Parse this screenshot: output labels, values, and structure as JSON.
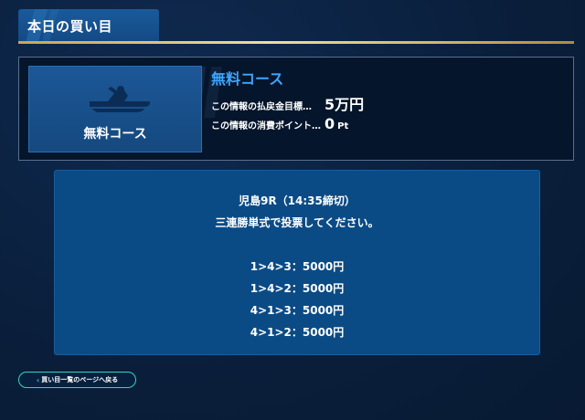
{
  "header": {
    "tab_title": "本日の買い目"
  },
  "course": {
    "thumbnail_label": "無料コース",
    "title": "無料コース",
    "rows": [
      {
        "label": "この情報の払戻金目標…",
        "value": "5万円",
        "unit": ""
      },
      {
        "label": "この情報の消費ポイント…",
        "value": "0",
        "unit": "Pt"
      }
    ],
    "thumbnail_icon": "boat-icon"
  },
  "bet": {
    "race": "児島9R（14:35締切）",
    "instruction": "三連勝単式で投票してください。",
    "combos": [
      "1>4>3：5000円",
      "1>4>2：5000円",
      "4>1>3：5000円",
      "4>1>2：5000円"
    ]
  },
  "footer": {
    "back_label": "買い目一覧のページへ戻る",
    "back_icon": "chevron-left-icon"
  },
  "colors": {
    "background": "#0a1f3c",
    "accent_blue": "#3fa6ff",
    "gold": "#d8b56a",
    "button_border": "#37d3b6"
  }
}
